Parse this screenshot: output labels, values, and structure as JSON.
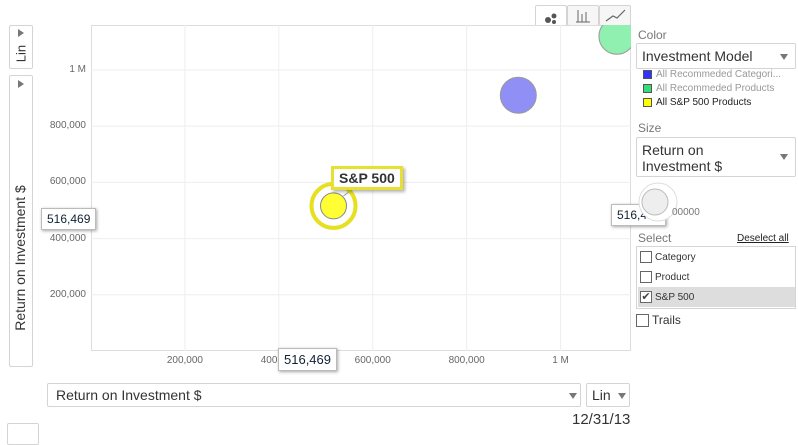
{
  "chart_data": {
    "type": "scatter",
    "xlabel": "Return on Investment $",
    "ylabel": "Return on Investment $",
    "x_ticks": [
      "200,000",
      "400,000",
      "600,000",
      "800,000",
      "1 M"
    ],
    "y_ticks": [
      "200,000",
      "400,000",
      "600,000",
      "800,000",
      "1 M"
    ],
    "xlim": [
      0,
      1150000
    ],
    "ylim": [
      0,
      1160000
    ],
    "points": [
      {
        "name": "All Recommeded Categories",
        "x": 910000,
        "y": 910000,
        "color": "#8f8ff5"
      },
      {
        "name": "All Recommeded Products",
        "x": 1120000,
        "y": 1120000,
        "color": "#8ff0b0"
      },
      {
        "name": "S&P 500",
        "x": 516469,
        "y": 516469,
        "color": "#ffff33",
        "selected": true
      }
    ]
  },
  "chart_ui": {
    "y_scale": "Lin",
    "x_scale": "Lin",
    "x_axis_select": "Return on Investment $",
    "y_value_box": "516,469",
    "x_value_box": "516,469",
    "right_value_box": "516,469",
    "tooltip": "S&P 500",
    "date": "12/31/13",
    "view_tabs": [
      "bubble-view-icon",
      "bar-view-icon",
      "line-view-icon"
    ]
  },
  "panel": {
    "color_title": "Color",
    "color_select": "Investment Model",
    "legend": [
      {
        "label": "All Recommeded Categori...",
        "color": "#3333ff",
        "dim": true
      },
      {
        "label": "All Recommeded Products",
        "color": "#33dd77",
        "dim": true
      },
      {
        "label": "All S&P 500 Products",
        "color": "#ffff00",
        "dim": false
      }
    ],
    "size_title": "Size",
    "size_select": "Return on Investment $",
    "size_value_partial": "00000",
    "select_title": "Select",
    "deselect_all": "Deselect all",
    "select_items": [
      {
        "label": "Category",
        "checked": false
      },
      {
        "label": "Product",
        "checked": false
      },
      {
        "label": "S&P 500",
        "checked": true
      }
    ],
    "trails_label": "Trails"
  }
}
